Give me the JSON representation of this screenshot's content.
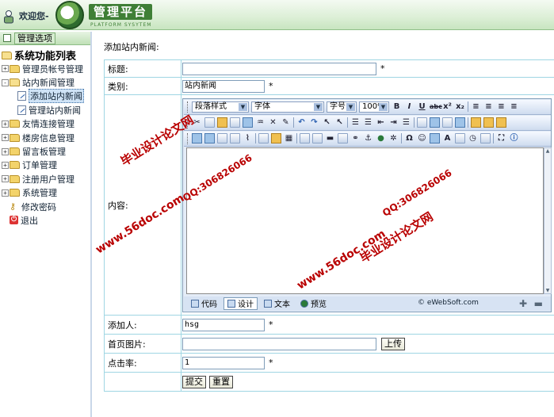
{
  "header": {
    "welcome": "欢迎您-",
    "title": "管理平台",
    "subtitle": "PLATFORM SYSYTEM"
  },
  "sidebar": {
    "header_label": "管理选项",
    "root_label": "系统功能列表",
    "items": [
      {
        "label": "管理员帐号管理",
        "level": 1,
        "kind": "folder",
        "expanded": false
      },
      {
        "label": "站内新闻管理",
        "level": 1,
        "kind": "folder",
        "expanded": true
      },
      {
        "label": "添加站内新闻",
        "level": 2,
        "kind": "doc",
        "active": true
      },
      {
        "label": "管理站内新闻",
        "level": 2,
        "kind": "doc"
      },
      {
        "label": "友情连接管理",
        "level": 1,
        "kind": "folder",
        "expanded": false
      },
      {
        "label": "楼房信息管理",
        "level": 1,
        "kind": "folder",
        "expanded": false
      },
      {
        "label": "留言板管理",
        "level": 1,
        "kind": "folder",
        "expanded": false
      },
      {
        "label": "订单管理",
        "level": 1,
        "kind": "folder",
        "expanded": false
      },
      {
        "label": "注册用户管理",
        "level": 1,
        "kind": "folder",
        "expanded": false
      },
      {
        "label": "系统管理",
        "level": 1,
        "kind": "folder",
        "expanded": false
      },
      {
        "label": "修改密码",
        "level": 1,
        "kind": "key"
      },
      {
        "label": "退出",
        "level": 1,
        "kind": "exit"
      }
    ]
  },
  "main": {
    "page_title": "添加站内新闻:",
    "form": {
      "title_label": "标题:",
      "title_value": "",
      "category_label": "类别:",
      "category_value": "站内新闻",
      "content_label": "内容:",
      "author_label": "添加人:",
      "author_value": "hsg",
      "image_label": "首页图片:",
      "image_value": "",
      "upload_button": "上传",
      "clicks_label": "点击率:",
      "clicks_value": "1",
      "required_mark": "*",
      "submit_button": "提交",
      "reset_button": "重置"
    },
    "editor": {
      "paragraph_style": "段落样式",
      "font": "字体",
      "font_size": "字号",
      "zoom": "100%",
      "modes": [
        "代码",
        "设计",
        "文本",
        "预览"
      ],
      "active_mode": "设计",
      "brand": "© eWebSoft.com"
    }
  },
  "watermarks": [
    "毕业设计论文网",
    "QQ:306826066",
    "www.56doc.com"
  ]
}
